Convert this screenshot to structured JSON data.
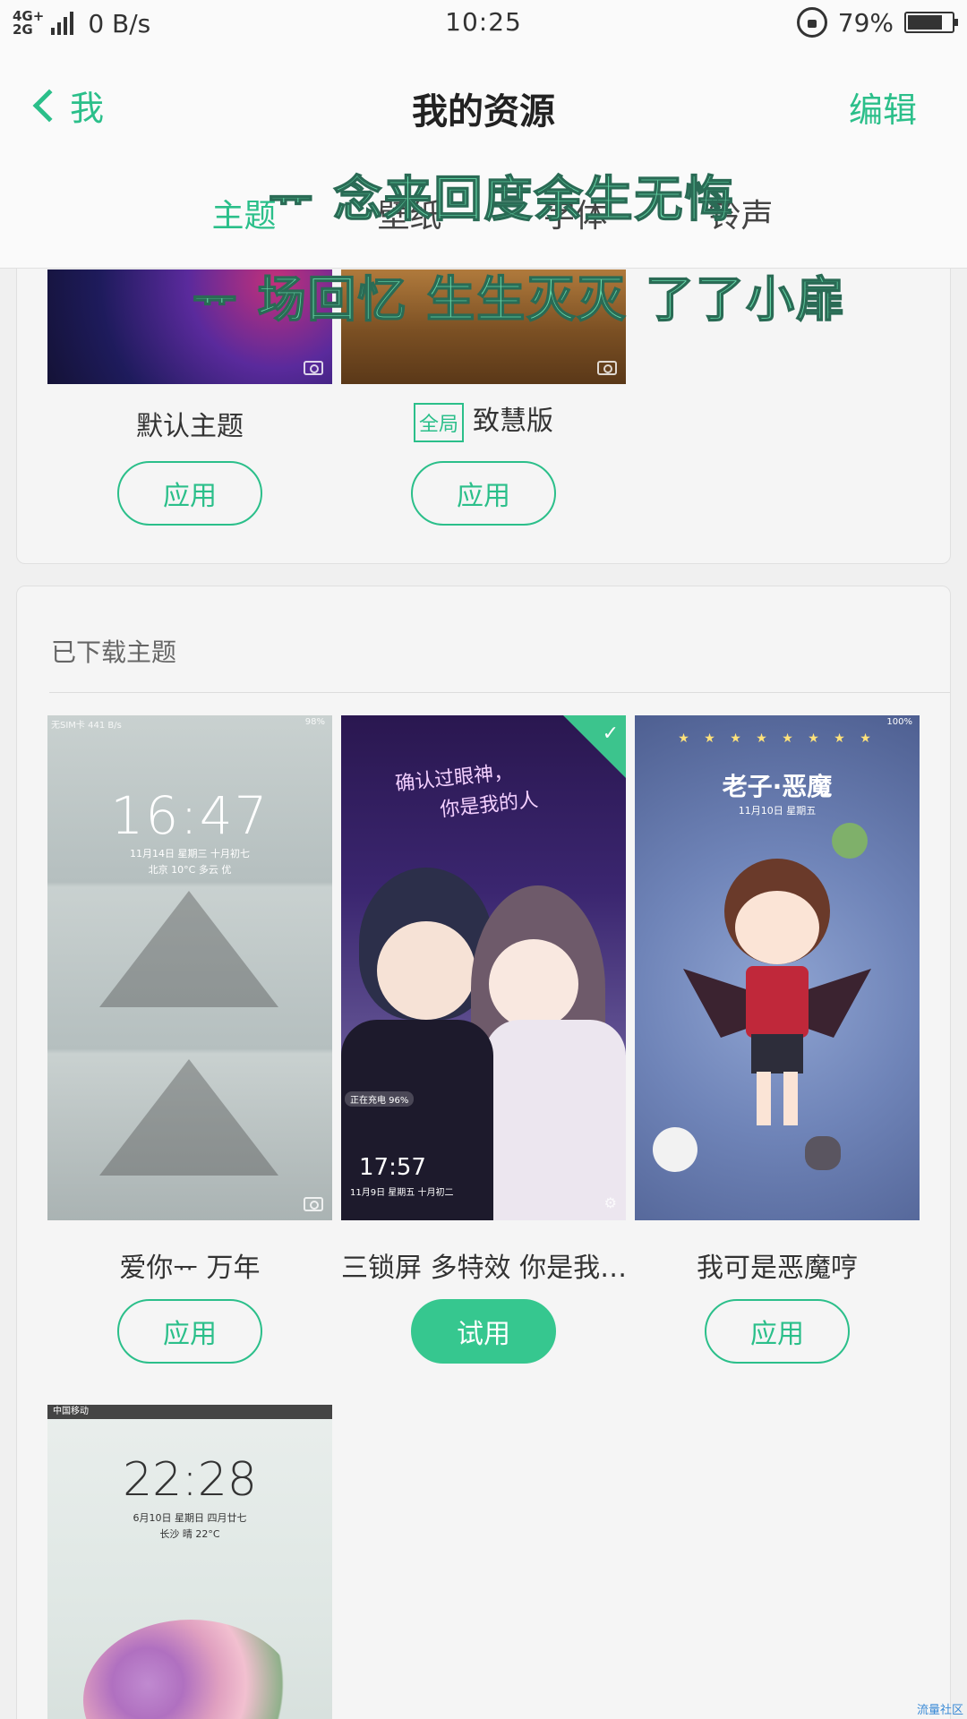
{
  "status": {
    "network_top": "4G+",
    "network_bottom": "2G",
    "speed": "0 B/s",
    "time": "10:25",
    "battery": "79%",
    "battery_level": 0.79
  },
  "header": {
    "back_label": "我",
    "title": "我的资源",
    "edit_label": "编辑",
    "tabs": [
      "主题",
      "壁纸",
      "字体",
      "铃声"
    ],
    "active_tab": 0
  },
  "overlay": {
    "line1": "ᅲ 念来回度余生无悔",
    "line2": "ᅲ 场回忆 生生灭灭 了了小扉"
  },
  "installed": [
    {
      "name": "默认主题",
      "action": "应用"
    },
    {
      "badge": "全局",
      "name": "致慧版",
      "action": "应用"
    }
  ],
  "downloaded": {
    "section_title": "已下载主题",
    "items": [
      {
        "name": "爱你ᅲ 万年",
        "action": "应用",
        "preview": {
          "status": "无SIM卡 441 B/s",
          "status_right": "98%",
          "clock": "16:47",
          "date": "11月14日 星期三 十月初七",
          "weather": "北京 10°C 多云 优"
        }
      },
      {
        "name": "三锁屏 多特效 你是我…",
        "action": "试用",
        "preview": {
          "line1": "确认过眼神，",
          "line2": "你是我的人",
          "charging": "正在充电 96%",
          "clock": "17:57",
          "date": "11月9日 星期五 十月初二"
        }
      },
      {
        "name": "我可是恶魔哼",
        "action": "应用",
        "preview": {
          "status_right": "100%",
          "title": "老子·恶魔",
          "date": "11月10日 星期五"
        }
      }
    ],
    "extra_preview": {
      "status": "中国移动",
      "clock": "22:28",
      "date": "6月10日 星期日 四月廿七",
      "weather": "长沙 晴 22°C"
    }
  },
  "footer": "流量社区"
}
